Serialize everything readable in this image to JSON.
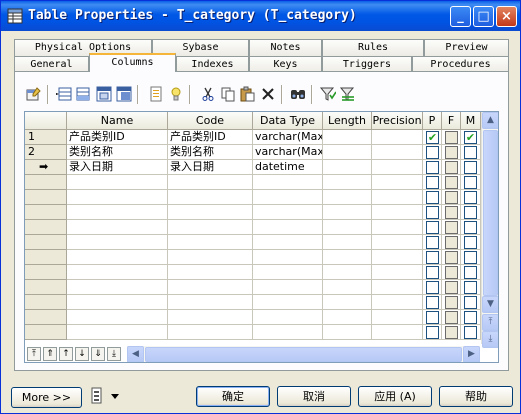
{
  "window": {
    "title": "Table Properties - T_category (T_category)",
    "minimize_glyph": "_",
    "maximize_glyph": "□",
    "close_glyph": "×"
  },
  "tabs": {
    "row1": [
      "Physical Options",
      "Sybase",
      "Notes",
      "Rules",
      "Preview"
    ],
    "row2": [
      "General",
      "Columns",
      "Indexes",
      "Keys",
      "Triggers",
      "Procedures"
    ],
    "active": "Columns"
  },
  "toolbar": {
    "icons": [
      "properties-icon",
      "insert-row-icon",
      "add-row-icon",
      "add-columns-icon",
      "reuse-columns-icon",
      "new-domain-icon",
      "rule-icon",
      "cut-icon",
      "copy-icon",
      "paste-icon",
      "delete-icon",
      "find-icon",
      "filter-icon",
      "clear-filter-icon"
    ]
  },
  "grid": {
    "columns": [
      "Name",
      "Code",
      "Data Type",
      "Length",
      "Precision",
      "P",
      "F",
      "M"
    ],
    "rows": [
      {
        "num": "1",
        "name": "产品类别ID",
        "code": "产品类别ID",
        "type": "varchar(Max)",
        "length": "",
        "precision": "",
        "p": true,
        "f": false,
        "m": true
      },
      {
        "num": "2",
        "name": "类别名称",
        "code": "类别名称",
        "type": "varchar(Max)",
        "length": "",
        "precision": "",
        "p": false,
        "f": false,
        "m": false
      },
      {
        "num": "➡",
        "name": "录入日期",
        "code": "录入日期",
        "type": "datetime",
        "length": "",
        "precision": "",
        "p": false,
        "f": false,
        "m": false
      }
    ],
    "check_mark": "✔",
    "nav_buttons": [
      "⤒",
      "⇑",
      "↑",
      "↓",
      "⇓",
      "⤓"
    ]
  },
  "footer": {
    "more_label": "More >>",
    "ok_label": "确定",
    "cancel_label": "取消",
    "apply_label": "应用 (A)",
    "help_label": "帮助"
  },
  "colors": {
    "titlebar": "#0054e3",
    "active_tab_accent": "#f5b43a",
    "check": "#21a121"
  }
}
